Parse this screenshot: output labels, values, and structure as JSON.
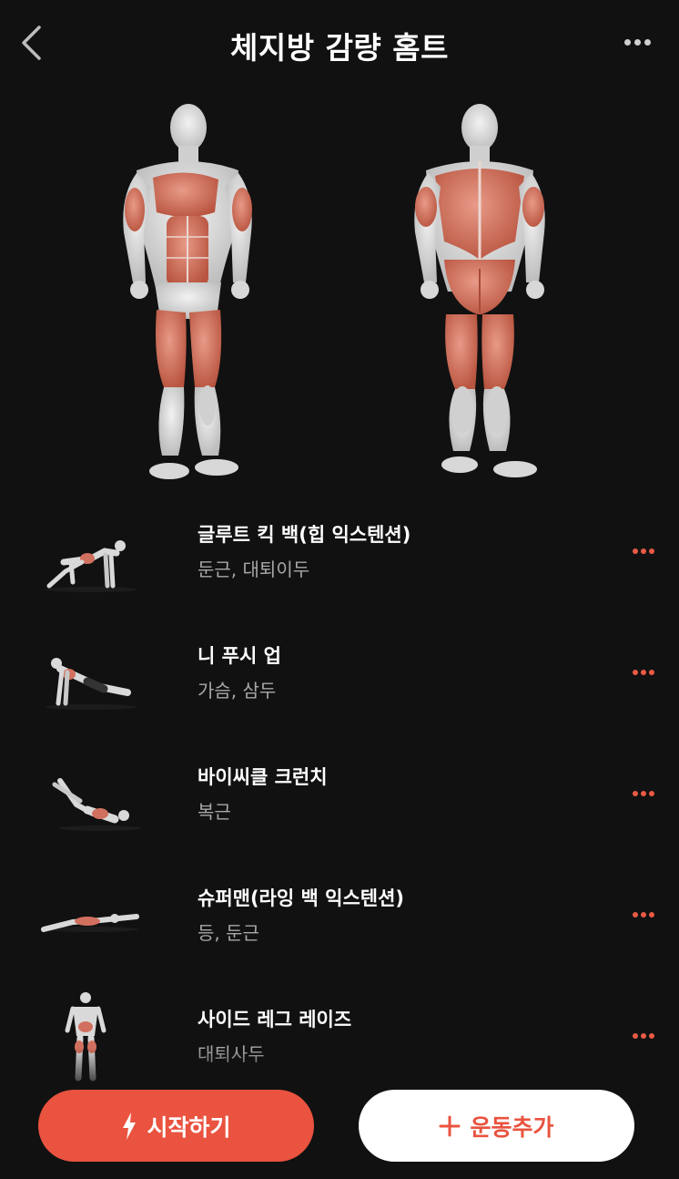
{
  "header": {
    "title": "체지방 감량 홈트",
    "back_icon": "chevron-left-icon",
    "more_icon": "more-horizontal-icon"
  },
  "colors": {
    "accent": "#e9533f",
    "background": "#111111",
    "muscle": "#d2705f",
    "secondary_text": "#a8a8a8"
  },
  "exercises": [
    {
      "name": "글루트 킥 백(힙 익스텐션)",
      "muscles": "둔근, 대퇴이두"
    },
    {
      "name": "니 푸시 업",
      "muscles": "가슴, 삼두"
    },
    {
      "name": "바이씨클 크런치",
      "muscles": "복근"
    },
    {
      "name": "슈퍼맨(라잉 백 익스텐션)",
      "muscles": "등, 둔근"
    },
    {
      "name": "사이드 레그 레이즈",
      "muscles": "대퇴사두"
    }
  ],
  "actions": {
    "start_label": "시작하기",
    "start_icon": "lightning-icon",
    "add_label": "운동추가",
    "add_icon": "plus-icon"
  }
}
